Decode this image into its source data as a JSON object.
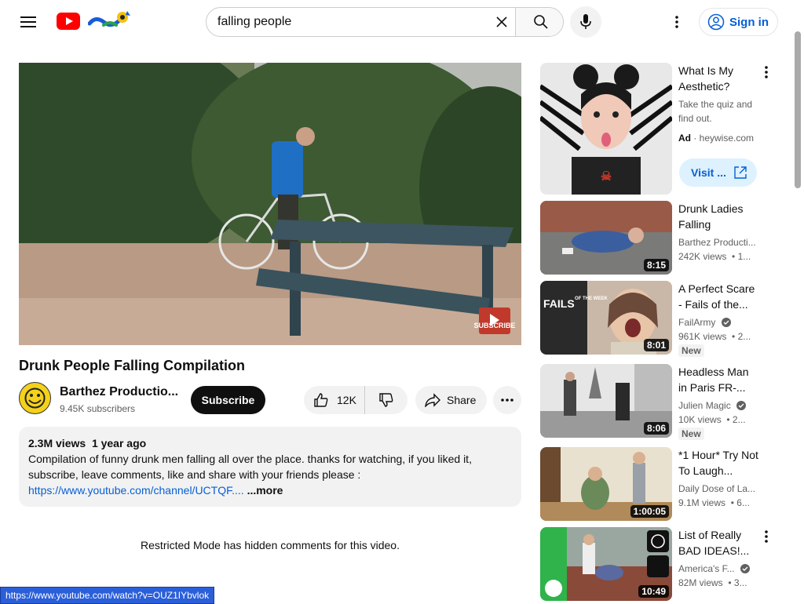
{
  "header": {
    "search_value": "falling people",
    "sign_in": "Sign in"
  },
  "video": {
    "title": "Drunk People Falling Compilation",
    "channel": "Barthez Productio...",
    "subscribers": "9.45K subscribers",
    "subscribe": "Subscribe",
    "likes": "12K",
    "share": "Share",
    "views": "2.3M views",
    "age": "1 year ago",
    "description": "Compilation of funny drunk men falling all over the place. thanks for watching, if you liked it, subscribe, leave comments, like and share with your friends please :",
    "link": "https://www.youtube.com/channel/UCTQF....",
    "more": "...more",
    "watermark": "SUBSCRIBE"
  },
  "comments_notice": "Restricted Mode has hidden comments for this video.",
  "status_url": "https://www.youtube.com/watch?v=OUZ1IYbvlok",
  "ad": {
    "title": "What Is My Aesthetic?",
    "body": "Take the quiz and find out.",
    "badge": "Ad",
    "domain": "heywise.com",
    "cta": "Visit ..."
  },
  "sidebar": [
    {
      "title": "Drunk Ladies Falling",
      "channel": "Barthez Producti...",
      "views": "242K views",
      "age": "1...",
      "duration": "8:15",
      "new": ""
    },
    {
      "title": "A Perfect Scare - Fails of the...",
      "channel": "FailArmy",
      "views": "961K views",
      "age": "2...",
      "duration": "8:01",
      "new": "New",
      "thumb_text": "FAILS",
      "thumb_text2": "OF THE WEEK"
    },
    {
      "title": "Headless Man in Paris FR-...",
      "channel": "Julien Magic",
      "views": "10K views",
      "age": "2...",
      "duration": "8:06",
      "new": "New"
    },
    {
      "title": "*1 Hour* Try Not To Laugh...",
      "channel": "Daily Dose of La...",
      "views": "9.1M views",
      "age": "6...",
      "duration": "1:00:05",
      "new": ""
    },
    {
      "title": "List of Really BAD IDEAS!...",
      "channel": "America's F...",
      "views": "82M views",
      "age": "3...",
      "duration": "10:49",
      "new": ""
    }
  ],
  "colors": {
    "brand_red": "#ff0000",
    "link_blue": "#065fd4",
    "text": "#0f0f0f",
    "muted": "#606060"
  }
}
